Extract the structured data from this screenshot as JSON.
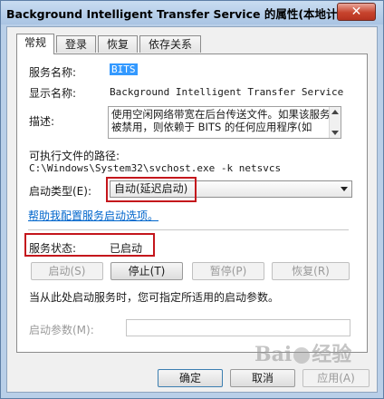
{
  "window": {
    "title": "Background Intelligent Transfer Service 的属性(本地计算机)",
    "close_glyph": "✕"
  },
  "tabs": [
    {
      "label": "常规",
      "active": true
    },
    {
      "label": "登录",
      "active": false
    },
    {
      "label": "恢复",
      "active": false
    },
    {
      "label": "依存关系",
      "active": false
    }
  ],
  "general": {
    "service_name_label": "服务名称:",
    "service_name_value": "BITS",
    "display_name_label": "显示名称:",
    "display_name_value": "Background Intelligent Transfer Service",
    "description_label": "描述:",
    "description_value": "使用空闲网络带宽在后台传送文件。如果该服务被禁用，则依赖于 BITS 的任何应用程序(如",
    "exe_path_label": "可执行文件的路径:",
    "exe_path_value": "C:\\Windows\\System32\\svchost.exe -k netsvcs",
    "startup_type_label": "启动类型(E):",
    "startup_type_value": "自动(延迟启动)",
    "help_link": "帮助我配置服务启动选项。",
    "status_label": "服务状态:",
    "status_value": "已启动",
    "start_hint": "当从此处启动服务时，您可指定所适用的启动参数。",
    "start_params_label": "启动参数(M):"
  },
  "service_buttons": {
    "start": "启动(S)",
    "stop": "停止(T)",
    "pause": "暂停(P)",
    "resume": "恢复(R)"
  },
  "dialog_buttons": {
    "ok": "确定",
    "cancel": "取消",
    "apply": "应用(A)"
  },
  "watermark": {
    "text_left": "Bai",
    "text_right": "经验"
  },
  "colors": {
    "highlight_box": "#c4161c",
    "link": "#0066cc",
    "selection": "#3399ff"
  }
}
